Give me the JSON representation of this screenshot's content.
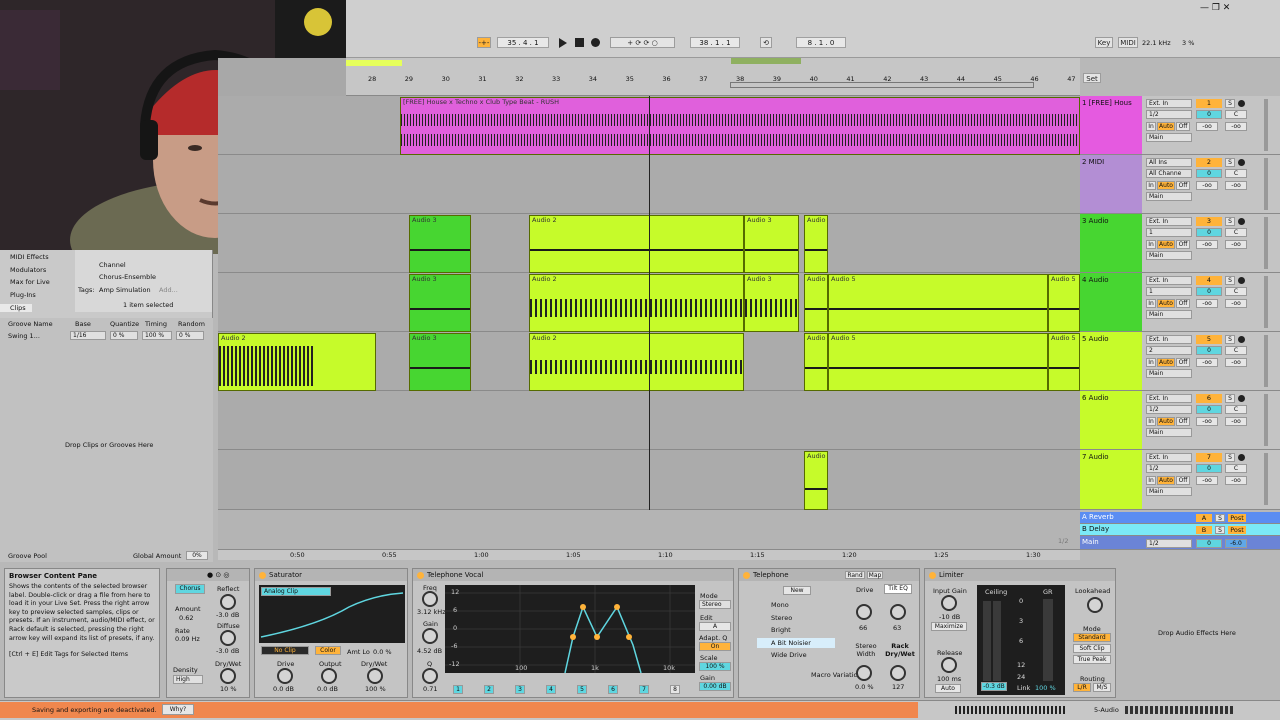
{
  "transport": {
    "tempo_marker": "-+-",
    "position": "35 .  4 .  1",
    "loop_start": "38 .  1 .  1",
    "loop_len": "8 .  1 .  0",
    "key_label": "Key",
    "midi_label": "MIDI",
    "sample_rate": "22.1 kHz",
    "cpu": "3 %"
  },
  "ruler": {
    "bars": [
      "28",
      "29",
      "30",
      "31",
      "32",
      "33",
      "34",
      "35",
      "36",
      "37",
      "38",
      "39",
      "40",
      "41",
      "42",
      "43",
      "44",
      "45",
      "46",
      "47"
    ],
    "set_label": "Set"
  },
  "time_ruler": {
    "marks": [
      "0:50",
      "0:55",
      "1:00",
      "1:05",
      "1:10",
      "1:15",
      "1:20",
      "1:25",
      "1:30"
    ],
    "fraction": "1/2"
  },
  "browser": {
    "sidebar": [
      "MIDI Effects",
      "Modulators",
      "Max for Live",
      "Plug-Ins",
      "Clips"
    ],
    "items": [
      "Channel",
      "Chorus-Ensemble"
    ],
    "tags_label": "Tags:",
    "tag_value": "Amp Simulation",
    "tag_add": "Add...",
    "selected_text": "1 item selected"
  },
  "groove": {
    "headers": [
      "Groove Name",
      "Base",
      "Quantize",
      "Timing",
      "Random"
    ],
    "row": [
      "Swing 1...",
      "1/16",
      "0 %",
      "100 %",
      "0 %"
    ],
    "drop_text": "Drop Clips or Grooves Here",
    "pool_label": "Groove Pool",
    "global_label": "Global Amount",
    "global_value": "0%"
  },
  "tracks": [
    {
      "name": "1 [FREE] Hous",
      "input": "Ext. In",
      "ch": "1/2",
      "out": "Main",
      "num": "1",
      "vol": "0",
      "pan": "C",
      "color": "#e55ae0"
    },
    {
      "name": "2 MIDI",
      "input": "All Ins",
      "ch": "All Channe",
      "out": "Main",
      "num": "2",
      "vol": "0",
      "pan": "C",
      "color": "#b38ed4"
    },
    {
      "name": "3 Audio",
      "input": "Ext. In",
      "ch": "1",
      "out": "Main",
      "num": "3",
      "vol": "0",
      "pan": "C",
      "color": "#47d631"
    },
    {
      "name": "4 Audio",
      "input": "Ext. In",
      "ch": "1",
      "out": "Main",
      "num": "4",
      "vol": "0",
      "pan": "C",
      "color": "#47d631"
    },
    {
      "name": "5 Audio",
      "input": "Ext. In",
      "ch": "2",
      "out": "Main",
      "num": "5",
      "vol": "0",
      "pan": "C",
      "color": "#c6fb2a"
    },
    {
      "name": "6 Audio",
      "input": "Ext. In",
      "ch": "1/2",
      "out": "Main",
      "num": "6",
      "vol": "0",
      "pan": "C",
      "color": "#c6fb2a"
    },
    {
      "name": "7 Audio",
      "input": "Ext. In",
      "ch": "1/2",
      "out": "Main",
      "num": "7",
      "vol": "0",
      "pan": "C",
      "color": "#c6fb2a"
    }
  ],
  "returns": [
    {
      "name": "A Reverb",
      "letter": "A",
      "post": "Post"
    },
    {
      "name": "B Delay",
      "letter": "B",
      "post": "Post"
    }
  ],
  "master": {
    "name": "Main",
    "ch": "1/2",
    "vol": "0",
    "pan": "-6.0"
  },
  "clips": {
    "main": "[FREE] House x Techno x Club Type Beat - RUSH",
    "a3": "Audio 3",
    "a2": "Audio 2",
    "a5": "Audio 5",
    "ag": "Audio ("
  },
  "toggles": {
    "in": "In",
    "auto": "Auto",
    "off": "Off",
    "s": "S",
    "inf": "-oo"
  },
  "info": {
    "title": "Browser Content Pane",
    "body": "Shows the contents of the selected browser label. Double-click or drag a file from here to load it in your Live Set. Press the right arrow key to preview selected samples, clips or presets. If an instrument, audio/MIDI effect, or Rack default is selected, pressing the right arrow key will expand its list of presets, if any.",
    "shortcut": "[Ctrl + E] Edit Tags for Selected Items"
  },
  "chorus": {
    "title": "Chorus",
    "amount_l": "Amount",
    "amount_v": "0.62",
    "rate_l": "Rate",
    "rate_v": "0.09 Hz",
    "reflect_l": "Reflect",
    "reflect_v": "-3.0 dB",
    "diffuse_l": "Diffuse",
    "diffuse_v": "-3.0 dB",
    "density_l": "Density",
    "density_v": "High",
    "drywet_l": "Dry/Wet",
    "drywet_v": "10 %"
  },
  "saturator": {
    "title": "Saturator",
    "mode": "Analog Clip",
    "noclip": "No Clip",
    "color": "Color",
    "amt_l": "Amt Lo",
    "amt_v": "0.0 %",
    "drive_l": "Drive",
    "drive_v": "0.0 dB",
    "output_l": "Output",
    "output_v": "0.0 dB",
    "drywet_l": "Dry/Wet",
    "drywet_v": "100 %"
  },
  "telvocal": {
    "title": "Telephone Vocal",
    "freq_l": "Freq",
    "freq_v": "3.12 kHz",
    "gain_l": "Gain",
    "gain_v": "4.52 dB",
    "q_l": "Q",
    "q_v": "0.71",
    "mode_l": "Mode",
    "mode_v": "Stereo",
    "edit_l": "Edit",
    "edit_v": "A",
    "adapt_l": "Adapt. Q",
    "adapt_v": "On",
    "scale_l": "Scale",
    "scale_v": "100 %",
    "gain2_l": "Gain",
    "gain2_v": "0.00 dB",
    "db": [
      "12",
      "6",
      "0",
      "-6",
      "-12"
    ],
    "hz": [
      "100",
      "1k",
      "10k"
    ],
    "bands": [
      "1",
      "2",
      "3",
      "4",
      "5",
      "6",
      "7",
      "8"
    ]
  },
  "telephone": {
    "title": "Telephone",
    "rand": "Rand",
    "map": "Map",
    "new": "New",
    "chains": [
      "Mono",
      "Stereo",
      "Bright",
      "A Bit Noisier",
      "Wide Drive"
    ],
    "drive_l": "Drive",
    "drive_v": "66",
    "tilt_l": "Tilt EQ",
    "tilt_v": "63",
    "stereo_l": "Stereo Width",
    "stereo_v": "0.0 %",
    "rack_l": "Rack Dry/Wet",
    "rack_v": "127",
    "macro": "Macro Variations"
  },
  "limiter": {
    "title": "Limiter",
    "input_l": "Input Gain",
    "input_v": "-10 dB",
    "maximize": "Maximize",
    "ceiling_l": "Ceiling",
    "gr_l": "GR",
    "ceiling_v": "-0.3 dB",
    "link_l": "Link",
    "link_v": "100 %",
    "release_l": "Release",
    "release_v": "100 ms",
    "auto": "Auto",
    "look_l": "Lookahead",
    "mode_l": "Mode",
    "mode_opts": [
      "Standard",
      "Soft Clip",
      "True Peak"
    ],
    "routing_l": "Routing",
    "routing_v": "L/R",
    "ms": "M/S",
    "scale": [
      "0",
      "3",
      "6",
      "12",
      "24"
    ]
  },
  "drop_fx": "Drop Audio Effects Here",
  "status": {
    "warning": "Saving and exporting are deactivated.",
    "why": "Why?",
    "track": "5-Audio"
  }
}
